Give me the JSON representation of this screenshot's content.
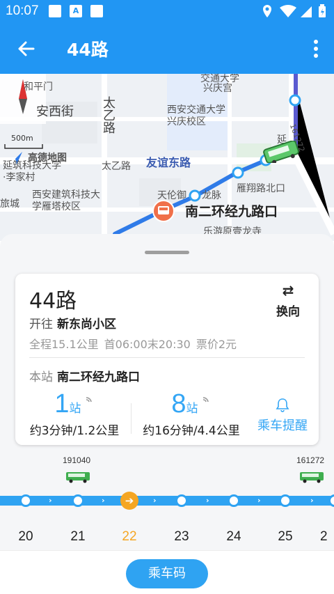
{
  "status_bar": {
    "time": "10:07",
    "notif_letter": "A"
  },
  "app_bar": {
    "title": "44路"
  },
  "map": {
    "labels": {
      "heping": "和平门",
      "anxi": "安西街",
      "taiyi_road_v": "太乙路",
      "jiaoda": "西安交通大学兴庆校区",
      "xingqing": "兴庆宫",
      "jiaotong_top": "交通大学",
      "yanxiang": "延",
      "gaode": "高德地图",
      "jianzhu1": "延筑科技大学·李家村",
      "taiyi_road_h": "太乙路",
      "youyi": "友谊东路",
      "yanta_north": "雁翔路北口",
      "tianlun": "天伦御",
      "longmai": "龙脉",
      "jianzhu2": "西安建筑科技大学雁塔校区",
      "lvguan": "旅城",
      "leyou": "乐游原壹龙寺",
      "scale": "500m",
      "bus_plate": "161272"
    },
    "stop_name": "南二环经九路口"
  },
  "card": {
    "route_name": "44路",
    "dest_label": "开往",
    "dest_value": "新东尚小区",
    "total_distance": "全程15.1公里",
    "first_last": "首06:00末20:30",
    "fare": "票价2元",
    "reverse_label": "换向",
    "this_stop_label": "本站",
    "this_stop_value": "南二环经九路口",
    "eta1": {
      "count": "1",
      "unit": "站",
      "desc": "约3分钟/1.2公里"
    },
    "eta2": {
      "count": "8",
      "unit": "站",
      "desc": "约16分钟/4.4公里"
    },
    "remind_label": "乘车提醒"
  },
  "timeline": {
    "buses": [
      "191040",
      "161272"
    ],
    "stops": [
      "20",
      "21",
      "22",
      "23",
      "24",
      "25",
      "2"
    ],
    "current_stop": "22"
  },
  "bottom": {
    "ride_code_label": "乘车码"
  },
  "colors": {
    "primary": "#2196f3",
    "accent": "#2fa3f2",
    "current": "#f5a623"
  }
}
